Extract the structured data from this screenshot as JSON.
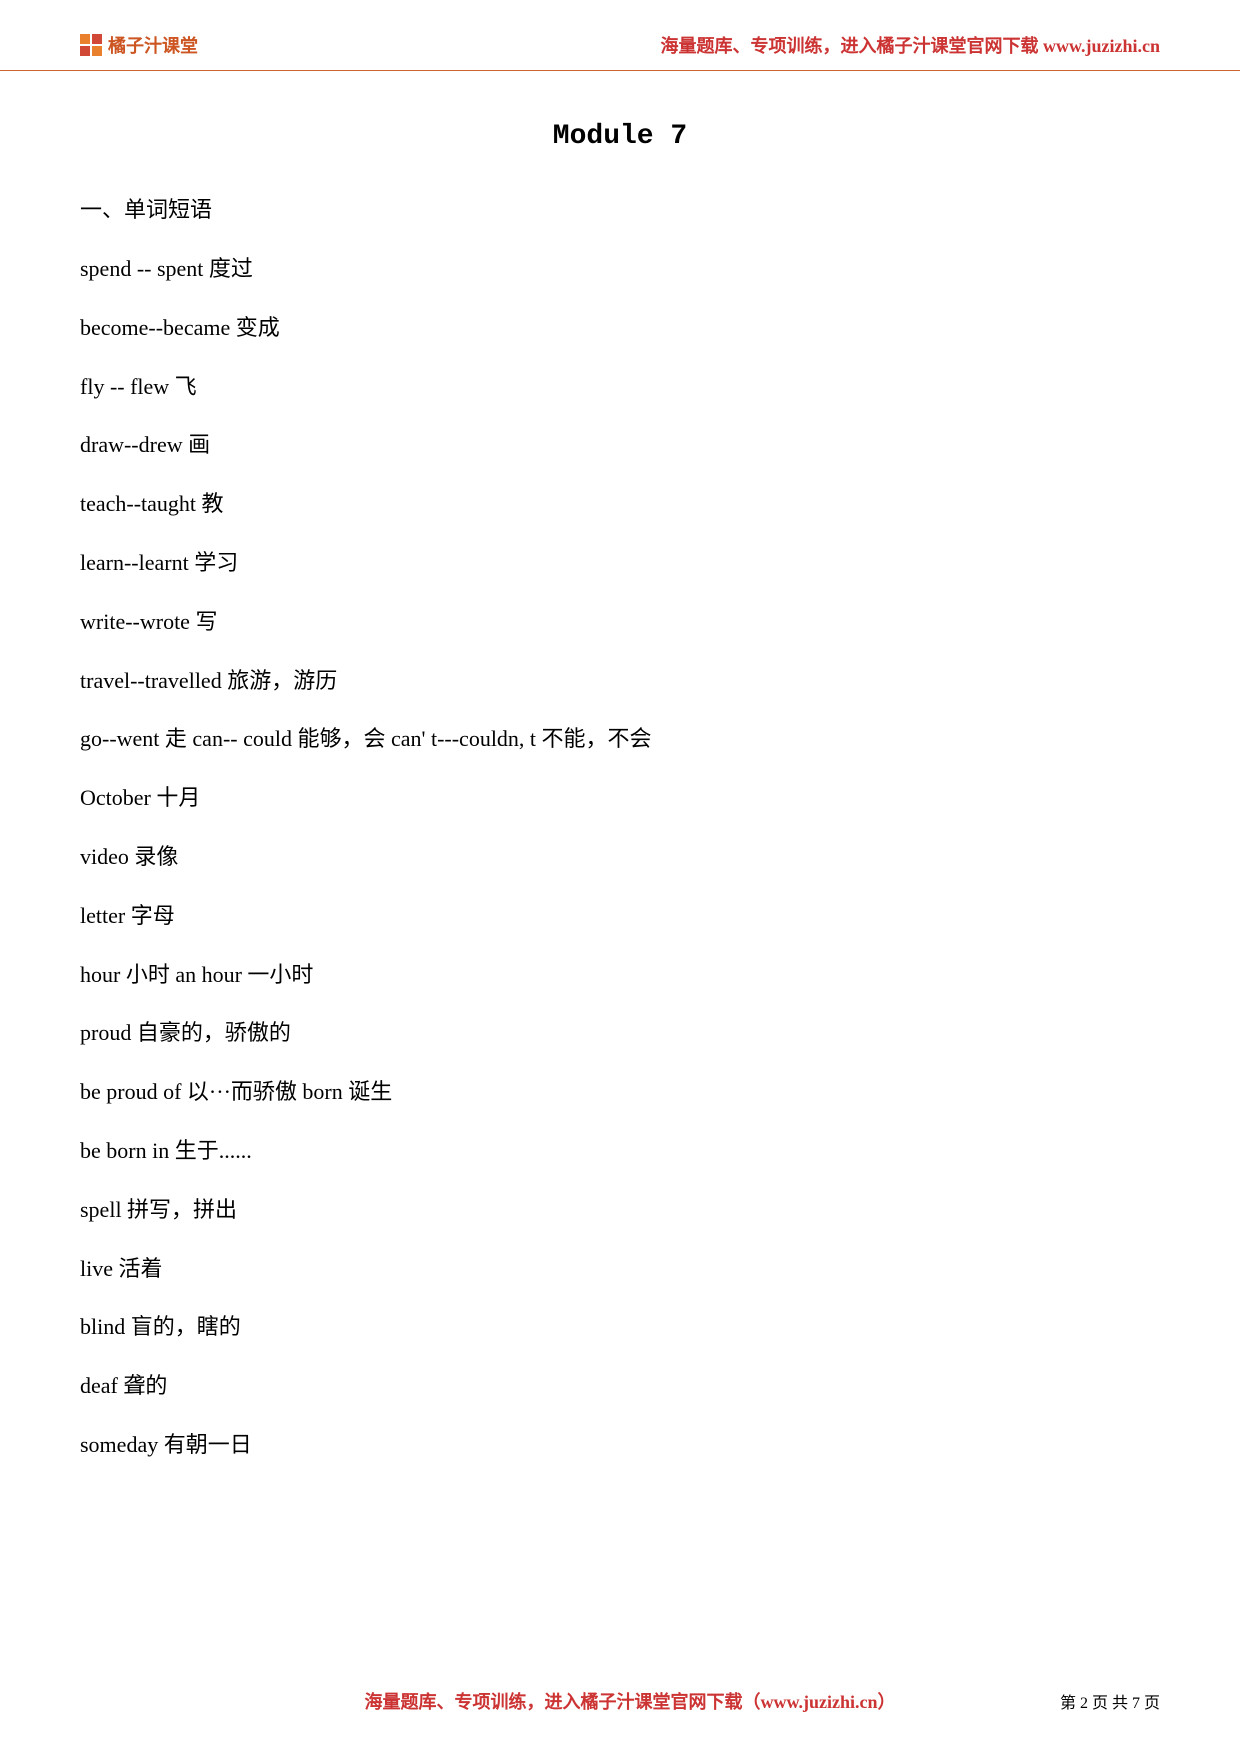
{
  "header": {
    "logo_text": "橘子汁课堂",
    "tagline": "海量题库、专项训练，进入橘子汁课堂官网下载 www.juzizhi.cn"
  },
  "title": "Module 7",
  "section_heading": "一、单词短语",
  "lines": [
    "spend -- spent 度过",
    "become--became 变成",
    "fly -- flew 飞",
    "draw--drew 画",
    "teach--taught 教",
    "learn--learnt 学习",
    "write--wrote 写",
    "travel--travelled 旅游，游历",
    "go--went 走  can-- could 能够，会   can' t---couldn, t 不能，不会",
    "October 十月",
    "video 录像",
    "letter 字母",
    "hour 小时  an hour 一小时",
    "proud 自豪的，骄傲的",
    "be proud of   以···而骄傲  born 诞生",
    "be born in 生于......",
    "spell 拼写，拼出",
    "live 活着",
    "blind 盲的，瞎的",
    "deaf 聋的",
    "someday 有朝一日"
  ],
  "footer": {
    "tagline": "海量题库、专项训练，进入橘子汁课堂官网下载（www.juzizhi.cn）",
    "page_info": "第 2 页 共 7 页"
  }
}
